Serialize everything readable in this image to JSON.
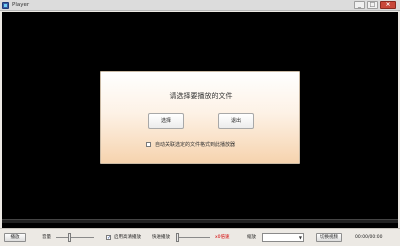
{
  "window": {
    "title": "Player",
    "minimize_glyph": "_",
    "maximize_glyph": "□",
    "close_glyph": "×"
  },
  "dialog": {
    "prompt": "请选择要播放的文件",
    "select_button": "选择",
    "exit_button": "退出",
    "associate_checkbox_label": "自动关联选定的文件格式到此播放器",
    "associate_checked": false
  },
  "progress": {
    "fraction": 0.0
  },
  "toolbar": {
    "play_button": "播放",
    "volume_label": "音量",
    "volume_level": 0.35,
    "hq_checkbox_label": "启用高清播放",
    "hq_checked": true,
    "fast_play_label": "快进播放",
    "fast_play_level": 0.0,
    "speed_text": "x0倍速",
    "scale_label": "缩放",
    "scale_value": "",
    "switch_button": "切换视频",
    "time": "00:00/00:00"
  },
  "colors": {
    "video_background": "#000000",
    "speed_text": "#d40000",
    "close_button": "#c9483b"
  },
  "icons": [
    "app-icon",
    "minimize-icon",
    "maximize-icon",
    "close-icon",
    "dropdown-arrow-icon"
  ]
}
